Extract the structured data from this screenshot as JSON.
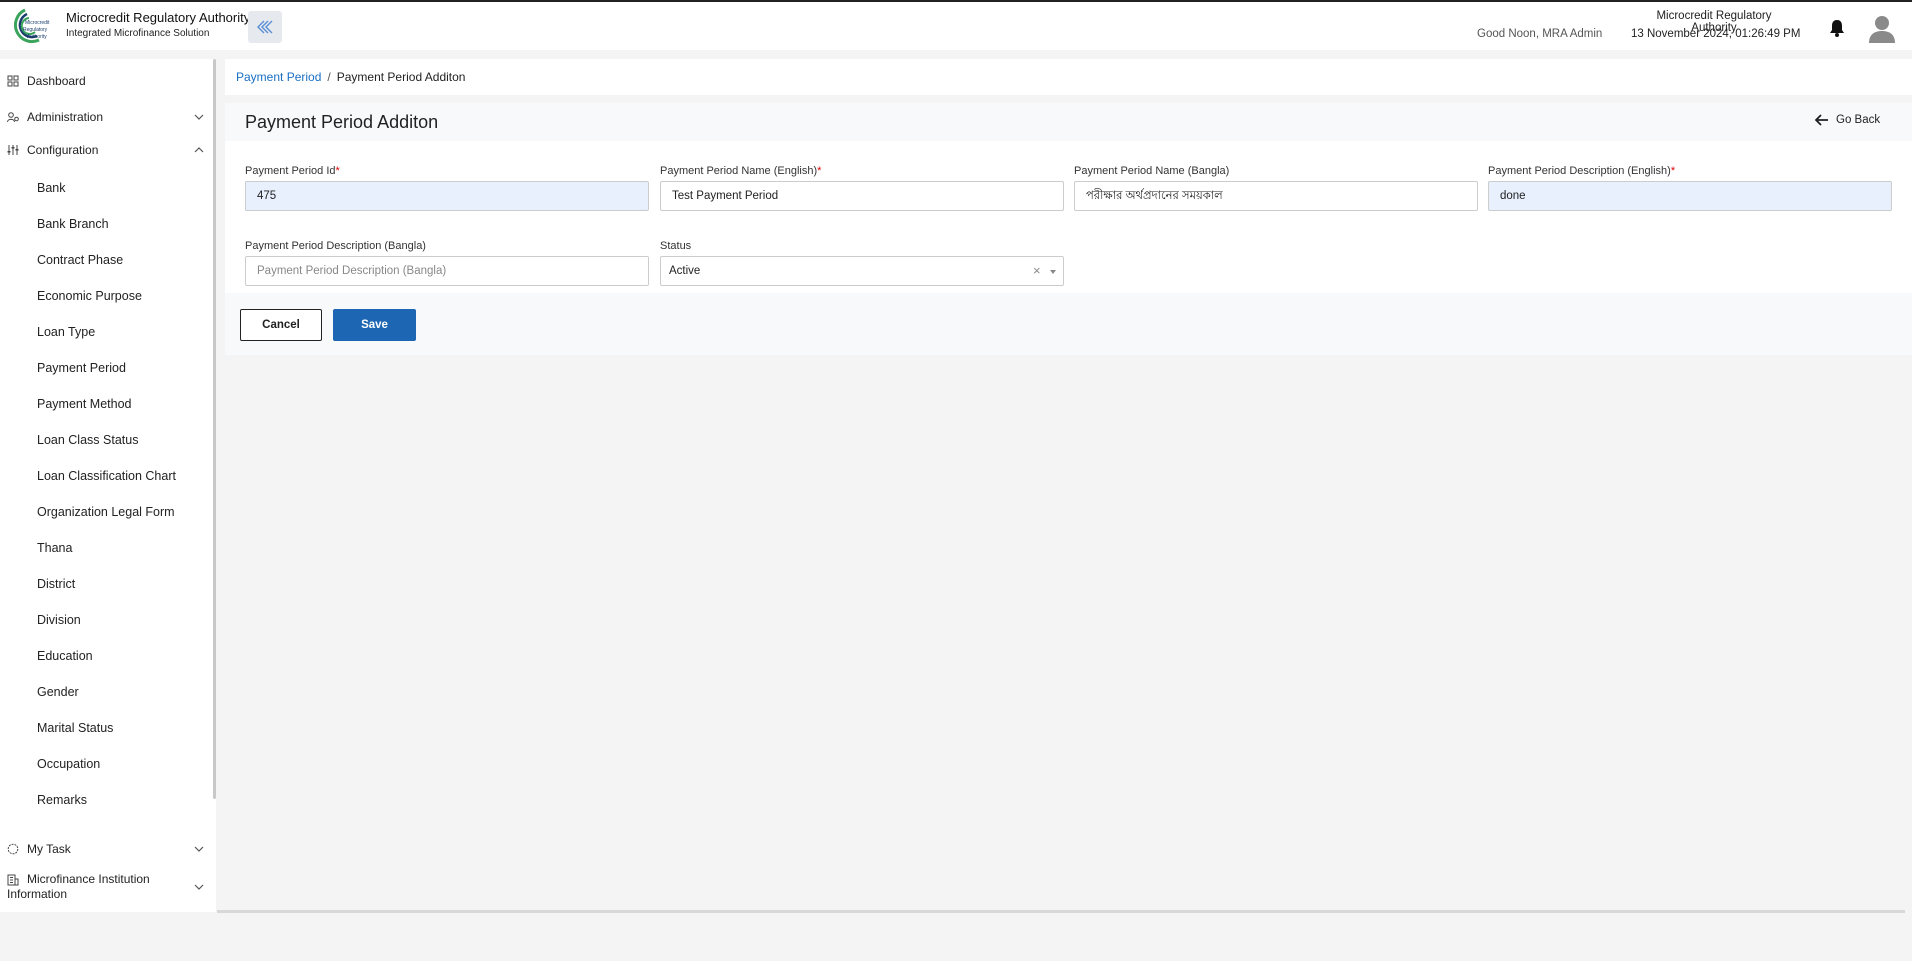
{
  "header": {
    "brand_title": "Microcredit Regulatory Authority",
    "brand_subtitle": "Integrated Microfinance Solution",
    "logo_text": "Microcredit Regulatory Authority",
    "greeting": "Good Noon, MRA Admin",
    "org_name": "Microcredit Regulatory Authority",
    "datetime": "13 November 2024, 01:26:49 PM"
  },
  "sidebar": {
    "dashboard": "Dashboard",
    "administration": "Administration",
    "configuration": "Configuration",
    "config_items": [
      "Bank",
      "Bank Branch",
      "Contract Phase",
      "Economic Purpose",
      "Loan Type",
      "Payment Period",
      "Payment Method",
      "Loan Class Status",
      "Loan Classification Chart",
      "Organization Legal Form",
      "Thana",
      "District",
      "Division",
      "Education",
      "Gender",
      "Marital Status",
      "Occupation",
      "Remarks"
    ],
    "my_task": "My Task",
    "mfi_info": "Microfinance Institution Information"
  },
  "breadcrumb": {
    "parent": "Payment Period",
    "separator": "/",
    "current": "Payment Period Additon"
  },
  "page": {
    "title": "Payment Period Additon",
    "go_back": "Go Back"
  },
  "form": {
    "id_label": "Payment Period Id",
    "id_value": "475",
    "name_en_label": "Payment Period Name (English)",
    "name_en_value": "Test Payment Period",
    "name_bn_label": "Payment Period Name (Bangla)",
    "name_bn_value": "পরীক্ষার অর্থপ্রদানের সময়কাল",
    "desc_en_label": "Payment Period Description (English)",
    "desc_en_value": "done",
    "desc_bn_label": "Payment Period Description (Bangla)",
    "desc_bn_placeholder": "Payment Period Description (Bangla)",
    "status_label": "Status",
    "status_value": "Active",
    "required_mark": "*",
    "clear_symbol": "×"
  },
  "actions": {
    "cancel": "Cancel",
    "save": "Save"
  },
  "colors": {
    "primary": "#1d66b3",
    "link": "#1a6fc4",
    "required": "#dd0000",
    "logo_green": "#3aa35c"
  }
}
